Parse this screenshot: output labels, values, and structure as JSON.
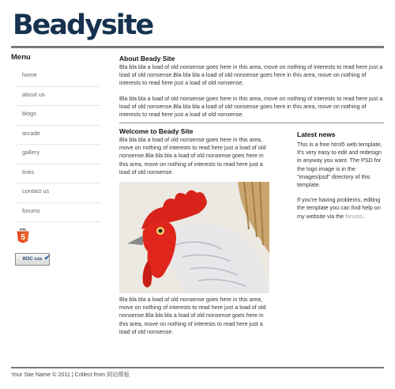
{
  "site": {
    "logo_text": "Beadysite"
  },
  "menu": {
    "title": "Menu",
    "items": [
      {
        "label": "home"
      },
      {
        "label": "about us"
      },
      {
        "label": "blogs"
      },
      {
        "label": "arcade"
      },
      {
        "label": "gallery"
      },
      {
        "label": "links"
      },
      {
        "label": "contact us"
      },
      {
        "label": "forums"
      }
    ],
    "html5_badge": "HTML",
    "w3c_badge": "W3C css"
  },
  "about": {
    "heading": "About Beady Site",
    "paragraph1": "Bla bla bla a load of old nonsense goes here in this area, move on nothing of interests to read here just a load of old nonsense.Bla bla bla a load of old nonsense goes here in this area, move on nothing of interests to read here just a load of old nonsense.",
    "paragraph2": "Bla bla bla a load of old nonsense goes here in this area, move on nothing of interests to read here just a load of old nonsense.Bla bla bla a load of old nonsense goes here in this area, move on nothing of interests to read here just a load of old nonsense."
  },
  "welcome": {
    "heading": "Welcome to Beady Site",
    "paragraph1": "Bla bla bla a load of old nonsense goes here in this area, move on nothing of interests to read here just a load of old nonsense.Bla bla bla a load of old nonsense goes here in this area, move on nothing of interests to read here just a load of old nonsense.",
    "paragraph2": "Bla bla bla a load of old nonsense goes here in this area, move on nothing of interests to read here just a load of old nonsense.Bla bla bla a load of old nonsense goes here in this area, move on nothing of interests to read here just a load of old nonsense."
  },
  "latest": {
    "heading": "Latest news",
    "paragraph1": "This is a free html5 web template, It's very easy to edit and redesign in anyway you want. The PSD for the logo image is in the \"images/psd\" directory of this template.",
    "paragraph2_prefix": "If you're having problems, editing the template you can find help on my website via the ",
    "paragraph2_link": "forums",
    "paragraph2_suffix": "."
  },
  "footer": {
    "text": "Your Site Name © 2011 | Collect from ",
    "link": "网站模板"
  },
  "colors": {
    "logo": "#16324f",
    "rule": "#7a7a7a",
    "rooster_comb": "#d8231a",
    "rooster_body": "#e9e9ec"
  },
  "icons": {
    "html5": "html5-icon",
    "w3c": "w3c-css-badge"
  }
}
